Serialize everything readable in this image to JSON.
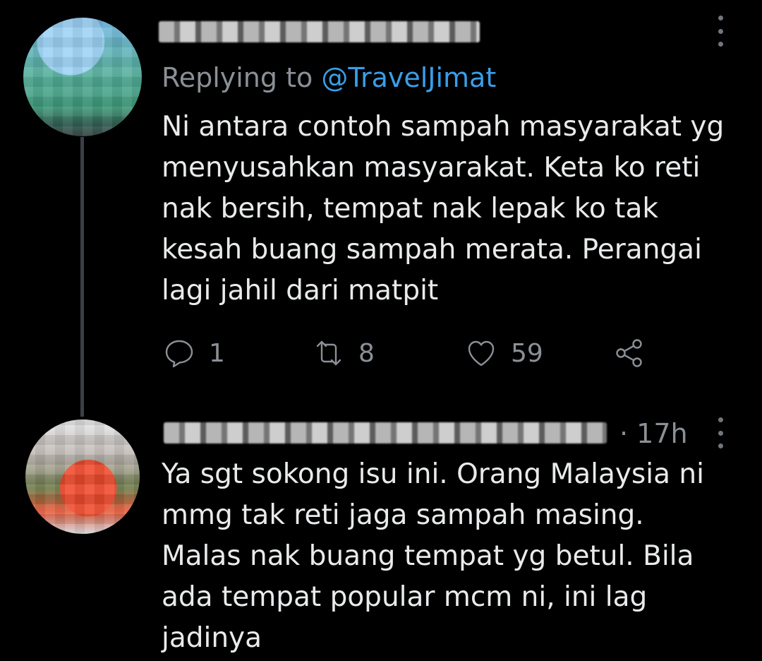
{
  "colors": {
    "background": "#000000",
    "text": "#e9eaeb",
    "secondary_text": "#8b9096",
    "link": "#3a9ee8",
    "thread_line": "#3c4046"
  },
  "tweets": [
    {
      "reply_prefix": "Replying to ",
      "reply_handle": "@TravelJimat",
      "text": "Ni antara contoh sampah masyarakat yg\nmenyusahkan masyarakat. Keta ko reti\nnak bersih, tempat nak lepak ko tak\nkesah buang sampah merata. Perangai\nlagi jahil dari matpit",
      "actions": {
        "reply_icon": "comment-icon",
        "reply_count": "1",
        "retweet_icon": "retweet-icon",
        "retweet_count": "8",
        "like_icon": "heart-icon",
        "like_count": "59",
        "share_icon": "share-icon"
      },
      "more_icon": "vertical-ellipsis-icon"
    },
    {
      "timestamp": "· 17h",
      "text": "Ya sgt sokong isu ini. Orang Malaysia ni\nmmg tak reti jaga sampah masing.\nMalas nak buang tempat yg betul. Bila\nada tempat popular mcm ni, ini lag\njadinya",
      "more_icon": "vertical-ellipsis-icon"
    }
  ]
}
